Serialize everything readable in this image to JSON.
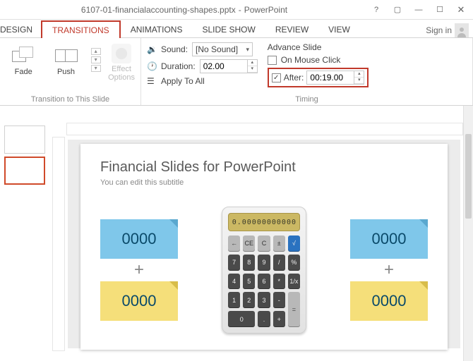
{
  "title": {
    "file": "6107-01-financialaccounting-shapes.pptx",
    "app": "PowerPoint"
  },
  "signin": "Sign in",
  "tabs": [
    "DESIGN",
    "TRANSITIONS",
    "ANIMATIONS",
    "SLIDE SHOW",
    "REVIEW",
    "VIEW"
  ],
  "active_tab": "TRANSITIONS",
  "ribbon": {
    "transition_group_label": "Transition to This Slide",
    "fade": "Fade",
    "push": "Push",
    "effect_options": "Effect\nOptions",
    "timing_label": "Timing",
    "sound_label": "Sound:",
    "sound_value": "[No Sound]",
    "duration_label": "Duration:",
    "duration_value": "02.00",
    "apply_all": "Apply To All",
    "advance_label": "Advance Slide",
    "on_mouse": "On Mouse Click",
    "after_label": "After:",
    "after_value": "00:19.00",
    "after_checked": true
  },
  "slide": {
    "title": "Financial Slides for PowerPoint",
    "subtitle": "You can edit this subtitle",
    "note1": "0000",
    "note2": "0000",
    "note3": "0000",
    "note4": "0000",
    "plus": "+",
    "calc_display": "0.00000000000",
    "keys_top": [
      "←",
      "CE",
      "C",
      "±",
      "√"
    ],
    "keys_r2": [
      "7",
      "8",
      "9",
      "/",
      "%"
    ],
    "keys_r3": [
      "4",
      "5",
      "6",
      "*",
      "1/x"
    ],
    "keys_r4": [
      "1",
      "2",
      "3",
      "-",
      "="
    ],
    "keys_r5": [
      "0",
      "",
      ".",
      "+",
      ""
    ]
  }
}
